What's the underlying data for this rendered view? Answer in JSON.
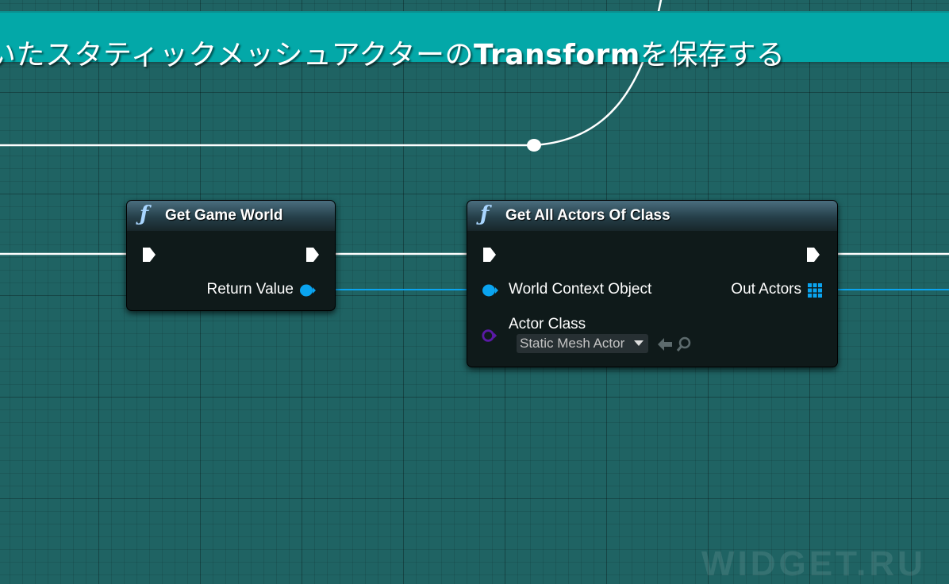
{
  "comment": {
    "text_part1": "いたスタティックメッシュアクターの",
    "text_bold": "Transform",
    "text_part2": "を保存する"
  },
  "get_game_world": {
    "title": "Get Game World",
    "icon": "function-icon",
    "return_value_label": "Return Value"
  },
  "get_all_actors": {
    "title": "Get All Actors Of Class",
    "icon": "function-icon",
    "world_context_label": "World Context Object",
    "actor_class_label": "Actor Class",
    "actor_class_value": "Static Mesh Actor",
    "out_actors_label": "Out Actors"
  },
  "watermark": "WIDGET.RU",
  "colors": {
    "background": "#1f6363",
    "comment_bar": "#03a8a8",
    "exec_wire": "#ffffff",
    "object_pin": "#0aa4f0",
    "class_pin": "#5a1aa6"
  }
}
